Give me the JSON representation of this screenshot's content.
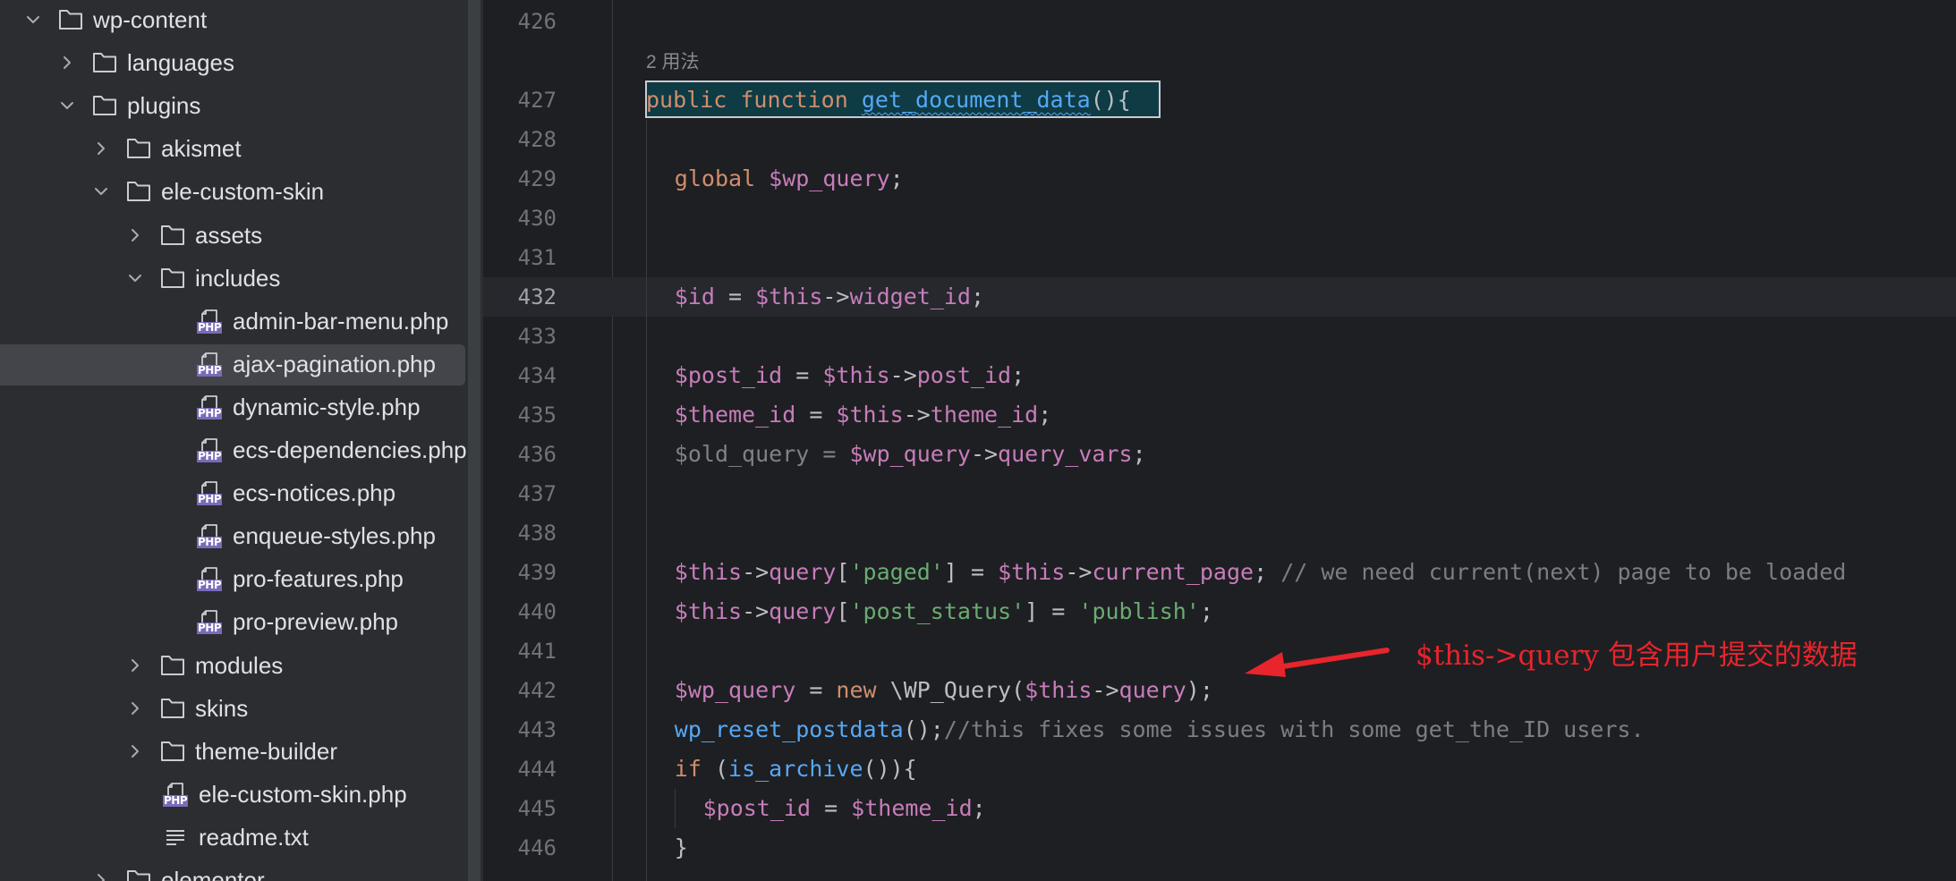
{
  "sidebar": {
    "items": [
      {
        "label": "wp-content",
        "type": "folder",
        "expanded": true
      },
      {
        "label": "languages",
        "type": "folder",
        "expanded": false
      },
      {
        "label": "plugins",
        "type": "folder",
        "expanded": true
      },
      {
        "label": "akismet",
        "type": "folder",
        "expanded": false
      },
      {
        "label": "ele-custom-skin",
        "type": "folder",
        "expanded": true
      },
      {
        "label": "assets",
        "type": "folder",
        "expanded": false
      },
      {
        "label": "includes",
        "type": "folder",
        "expanded": true
      },
      {
        "label": "admin-bar-menu.php",
        "type": "php"
      },
      {
        "label": "ajax-pagination.php",
        "type": "php",
        "selected": true
      },
      {
        "label": "dynamic-style.php",
        "type": "php"
      },
      {
        "label": "ecs-dependencies.php",
        "type": "php"
      },
      {
        "label": "ecs-notices.php",
        "type": "php"
      },
      {
        "label": "enqueue-styles.php",
        "type": "php"
      },
      {
        "label": "pro-features.php",
        "type": "php"
      },
      {
        "label": "pro-preview.php",
        "type": "php"
      },
      {
        "label": "modules",
        "type": "folder",
        "expanded": false
      },
      {
        "label": "skins",
        "type": "folder",
        "expanded": false
      },
      {
        "label": "theme-builder",
        "type": "folder",
        "expanded": false
      },
      {
        "label": "ele-custom-skin.php",
        "type": "php"
      },
      {
        "label": "readme.txt",
        "type": "text"
      },
      {
        "label": "elementor",
        "type": "folder",
        "expanded": false
      }
    ],
    "php_badge": "PHP"
  },
  "editor": {
    "usages_hint": "2 用法",
    "current_line": "432",
    "lines": [
      {
        "num": "426"
      },
      {
        "num": "427"
      },
      {
        "num": "428"
      },
      {
        "num": "429"
      },
      {
        "num": "430"
      },
      {
        "num": "431"
      },
      {
        "num": "432"
      },
      {
        "num": "433"
      },
      {
        "num": "434"
      },
      {
        "num": "435"
      },
      {
        "num": "436"
      },
      {
        "num": "437"
      },
      {
        "num": "438"
      },
      {
        "num": "439"
      },
      {
        "num": "440"
      },
      {
        "num": "441"
      },
      {
        "num": "442"
      },
      {
        "num": "443"
      },
      {
        "num": "444"
      },
      {
        "num": "445"
      },
      {
        "num": "446"
      }
    ],
    "code": {
      "l427": [
        [
          "kw",
          "public "
        ],
        [
          "kw",
          "function "
        ],
        [
          "fnu",
          "get_document_data"
        ],
        [
          "",
          "(){"
        ]
      ],
      "l429": [
        [
          "kw",
          "global "
        ],
        [
          "var",
          "$wp_query"
        ],
        [
          "",
          ";"
        ]
      ],
      "l432": [
        [
          "var",
          "$id"
        ],
        [
          "",
          " = "
        ],
        [
          "var",
          "$this"
        ],
        [
          "",
          "->"
        ],
        [
          "prop",
          "widget_id"
        ],
        [
          "",
          ";"
        ]
      ],
      "l434": [
        [
          "var",
          "$post_id"
        ],
        [
          "",
          " = "
        ],
        [
          "var",
          "$this"
        ],
        [
          "",
          "->"
        ],
        [
          "prop",
          "post_id"
        ],
        [
          "",
          ";"
        ]
      ],
      "l435": [
        [
          "var",
          "$theme_id"
        ],
        [
          "",
          " = "
        ],
        [
          "var",
          "$this"
        ],
        [
          "",
          "->"
        ],
        [
          "prop",
          "theme_id"
        ],
        [
          "",
          ";"
        ]
      ],
      "l436": [
        [
          "dim",
          "$old_query"
        ],
        [
          "dim",
          " = "
        ],
        [
          "var",
          "$wp_query"
        ],
        [
          "",
          "->"
        ],
        [
          "prop",
          "query_vars"
        ],
        [
          "",
          ";"
        ]
      ],
      "l439": [
        [
          "var",
          "$this"
        ],
        [
          "",
          "->"
        ],
        [
          "prop",
          "query"
        ],
        [
          "",
          "["
        ],
        [
          "str",
          "'paged'"
        ],
        [
          "",
          "] = "
        ],
        [
          "var",
          "$this"
        ],
        [
          "",
          "->"
        ],
        [
          "prop",
          "current_page"
        ],
        [
          "",
          "; "
        ],
        [
          "cmt",
          "// we need current(next) page to be loaded"
        ]
      ],
      "l440": [
        [
          "var",
          "$this"
        ],
        [
          "",
          "->"
        ],
        [
          "prop",
          "query"
        ],
        [
          "",
          "["
        ],
        [
          "str",
          "'post_status'"
        ],
        [
          "",
          "] = "
        ],
        [
          "str",
          "'publish'"
        ],
        [
          "",
          ";"
        ]
      ],
      "l442": [
        [
          "var",
          "$wp_query"
        ],
        [
          "",
          " = "
        ],
        [
          "kw",
          "new "
        ],
        [
          "",
          "\\WP_Query("
        ],
        [
          "var",
          "$this"
        ],
        [
          "",
          "->"
        ],
        [
          "prop",
          "query"
        ],
        [
          "",
          ");"
        ]
      ],
      "l443": [
        [
          "fncall",
          "wp_reset_postdata"
        ],
        [
          "",
          "();"
        ],
        [
          "cmt",
          "//this fixes some issues with some get_the_ID users."
        ]
      ],
      "l444": [
        [
          "kw",
          "if "
        ],
        [
          "",
          "("
        ],
        [
          "fncall",
          "is_archive"
        ],
        [
          "",
          "()){"
        ]
      ],
      "l445": [
        [
          "var",
          "$post_id"
        ],
        [
          "",
          " = "
        ],
        [
          "var",
          "$theme_id"
        ],
        [
          "",
          ";"
        ]
      ],
      "l446": [
        [
          "",
          "}"
        ]
      ]
    }
  },
  "annotation": {
    "text": "$this->query 包含用户提交的数据",
    "color": "#e8242c"
  }
}
